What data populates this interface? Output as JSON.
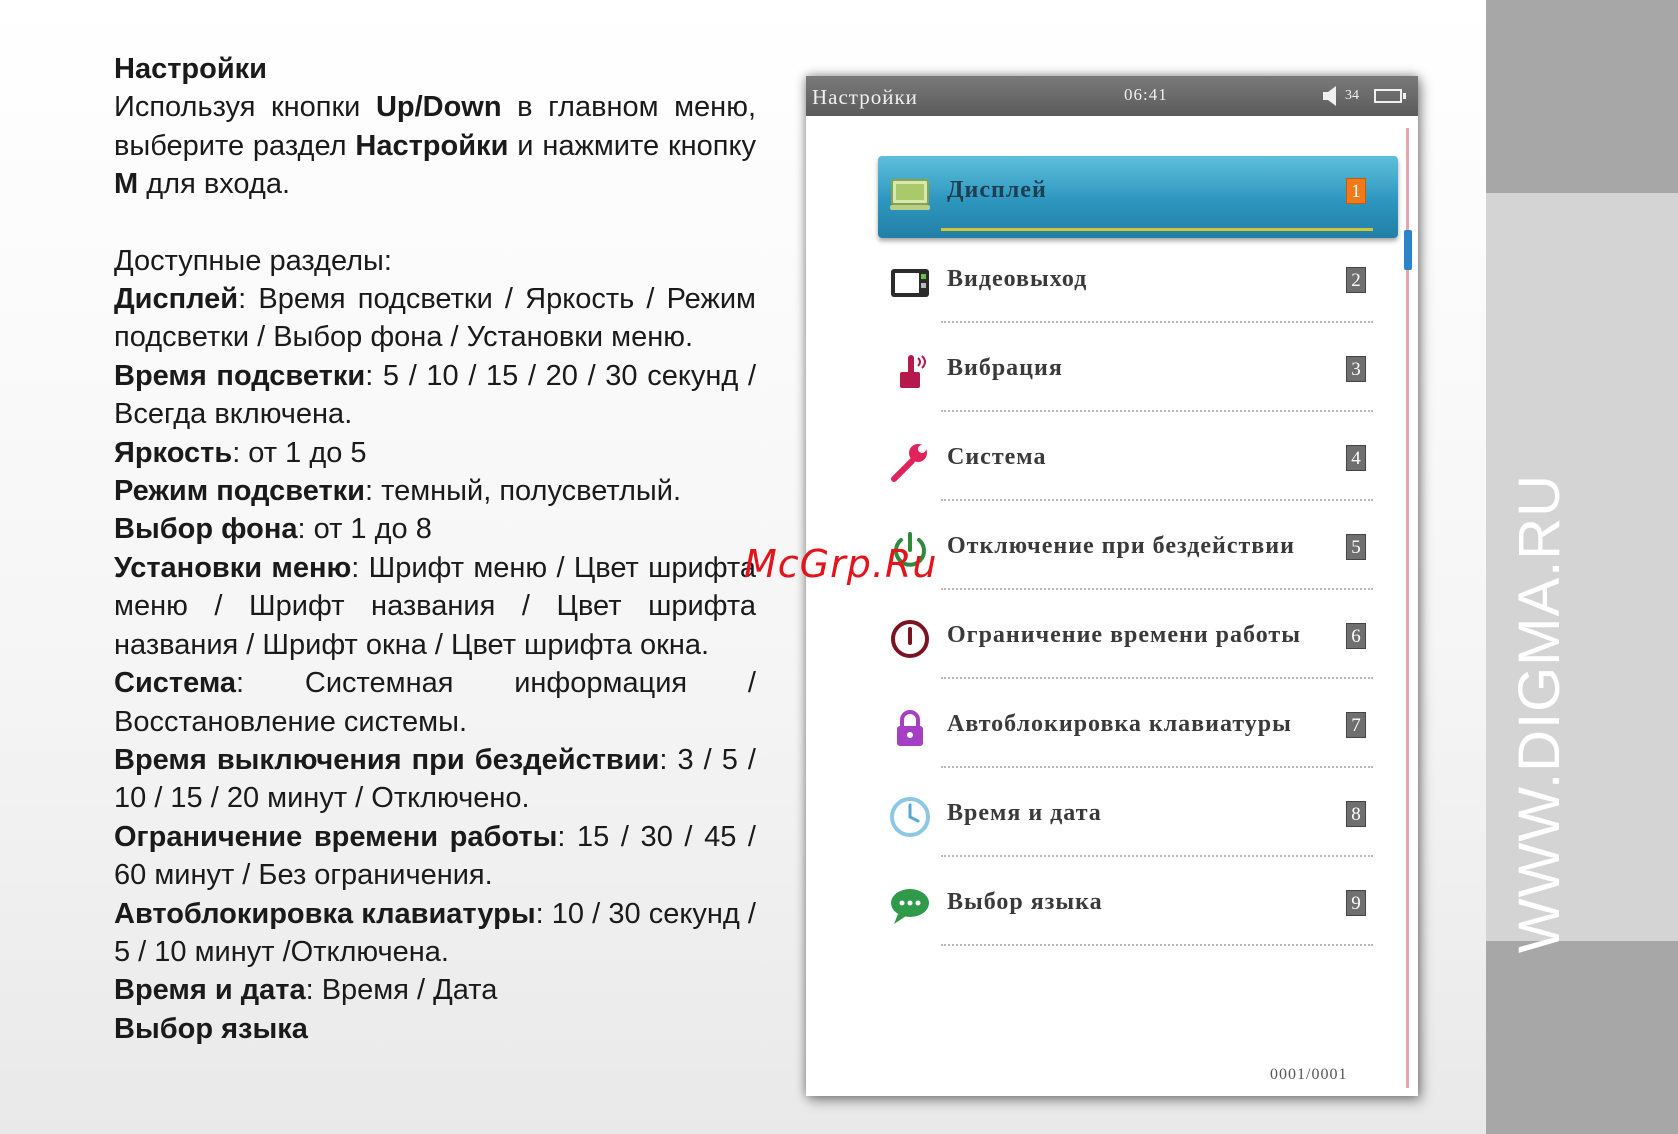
{
  "text": {
    "heading": "Настройки",
    "intro": {
      "p1": "Используя кнопки ",
      "b1": "Up/Down",
      "p2": " в главном меню, выберите раздел ",
      "b2": "Настройки",
      "p3": " и нажмите кнопку ",
      "b3": "M",
      "p4": " для входа."
    },
    "sections_label": "Доступные разделы:",
    "entries": [
      {
        "term": "Дисплей",
        "desc": ": Время подсветки / Яркость / Режим подсветки / Выбор фона / Установки меню."
      },
      {
        "term": "Время подсветки",
        "desc": ": 5 / 10 / 15 / 20 / 30 секунд / Всегда включена."
      },
      {
        "term": "Яркость",
        "desc": ": от 1 до 5"
      },
      {
        "term": "Режим подсветки",
        "desc": ": темный, полусветлый."
      },
      {
        "term": "Выбор фона",
        "desc": ": от 1 до 8"
      },
      {
        "term": "Установки меню",
        "desc": ": Шрифт меню / Цвет шрифта меню / Шрифт названия / Цвет шрифта названия / Шрифт окна / Цвет шрифта окна."
      },
      {
        "term": "Система",
        "desc": ": Системная информация / Восстановление системы."
      },
      {
        "term": "Время выключения при бездействии",
        "desc": ": 3 / 5 / 10 / 15 / 20 минут / Отключено."
      },
      {
        "term": "Ограничение времени работы",
        "desc": ": 15 / 30 / 45 / 60 минут / Без ограничения."
      },
      {
        "term": "Автоблокировка клавиатуры",
        "desc": ": 10 / 30 секунд / 5 / 10 минут /Отключена."
      },
      {
        "term": "Время и дата",
        "desc": ": Время / Дата"
      },
      {
        "term": "Выбор языка",
        "desc": ""
      }
    ]
  },
  "screen": {
    "status_bar": {
      "title": "Настройки",
      "time": "06:41",
      "volume": "34",
      "speaker_icon": "speaker-icon",
      "battery_icon": "battery-icon"
    },
    "menu_items": [
      {
        "label": "Дисплей",
        "number": "1",
        "icon": "display-icon",
        "selected": true
      },
      {
        "label": "Видеовыход",
        "number": "2",
        "icon": "video-out-icon",
        "selected": false
      },
      {
        "label": "Вибрация",
        "number": "3",
        "icon": "vibration-icon",
        "selected": false
      },
      {
        "label": "Система",
        "number": "4",
        "icon": "wrench-icon",
        "selected": false
      },
      {
        "label": "Отключение при бездействии",
        "number": "5",
        "icon": "power-icon",
        "selected": false
      },
      {
        "label": "Ограничение времени работы",
        "number": "6",
        "icon": "time-limit-icon",
        "selected": false
      },
      {
        "label": "Автоблокировка клавиатуры",
        "number": "7",
        "icon": "lock-icon",
        "selected": false
      },
      {
        "label": "Время и дата",
        "number": "8",
        "icon": "clock-icon",
        "selected": false
      },
      {
        "label": "Выбор языка",
        "number": "9",
        "icon": "chat-icon",
        "selected": false
      }
    ],
    "page_indicator": "0001/0001"
  },
  "side_strip": {
    "text": "WWW.DIGMA.RU"
  },
  "watermark": "McGrp.Ru",
  "colors": {
    "selection": "#2d96be",
    "selection_underline": "#cfc535",
    "badge_selected": "#f07a1a",
    "badge": "#6f6f6f",
    "status_bar": "#6a6a6a",
    "watermark": "#e4141b",
    "strip_dark": "#a7a7a7",
    "strip_light": "#d4d4d4"
  }
}
